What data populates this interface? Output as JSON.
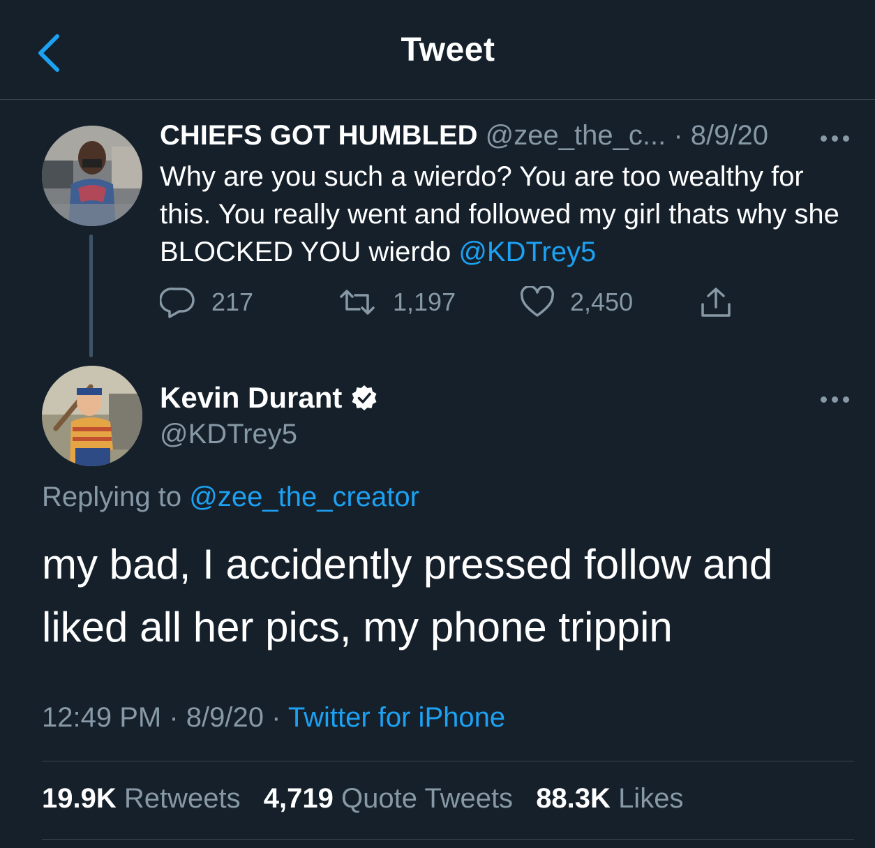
{
  "header": {
    "title": "Tweet",
    "back_icon": "chevron-left-icon"
  },
  "colors": {
    "background": "#15202b",
    "accent": "#1da1f2",
    "muted": "#8899a6",
    "divider": "#38444d"
  },
  "parent_tweet": {
    "display_name": "CHIEFS GOT HUMBLED",
    "handle": "@zee_the_c...",
    "separator": "·",
    "date": "8/9/20",
    "text_plain": "Why are you such a wierdo? You are too wealthy for this. You really went and followed my girl thats why she BLOCKED YOU wierdo",
    "mention": "@KDTrey5",
    "replies": "217",
    "retweets": "1,197",
    "likes": "2,450"
  },
  "main_tweet": {
    "display_name": "Kevin Durant",
    "handle": "@KDTrey5",
    "replying_label": "Replying to",
    "replying_to": "@zee_the_creator",
    "text": "my bad, I accidently pressed follow and liked all her pics, my phone trippin",
    "time": "12:49 PM",
    "sep1": "·",
    "date": "8/9/20",
    "sep2": "·",
    "source": "Twitter for iPhone"
  },
  "stats": {
    "retweets_count": "19.9K",
    "retweets_label": "Retweets",
    "quotes_count": "4,719",
    "quotes_label": "Quote Tweets",
    "likes_count": "88.3K",
    "likes_label": "Likes"
  }
}
